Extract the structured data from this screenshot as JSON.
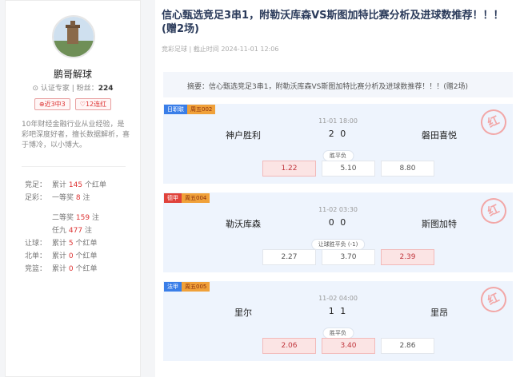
{
  "sidebar": {
    "username": "鹏哥解球",
    "cert_label": "认证专家",
    "fans_label": "粉丝：",
    "fans_count": "224",
    "badges": [
      "近3中3",
      "12连红"
    ],
    "bio": "10年财经金融行业从业经验，是彩吧深度好者，擅长数据解析，喜于博冷，以小博大。",
    "stats": {
      "jingzu": {
        "label": "竞足：",
        "prefix": "累计",
        "num": "145",
        "suffix": "个红单"
      },
      "zucai_1": {
        "label": "足彩：",
        "prefix": "一等奖",
        "num": "8",
        "suffix": "注"
      },
      "zucai_2": {
        "prefix": "二等奖",
        "num": "159",
        "suffix": "注"
      },
      "zucai_3": {
        "prefix": "任九",
        "num": "477",
        "suffix": "注"
      },
      "rangqiu": {
        "label": "让球：",
        "prefix": "累计",
        "num": "5",
        "suffix": "个红单"
      },
      "beidan": {
        "label": "北单：",
        "prefix": "累计",
        "num": "0",
        "suffix": "个红单"
      },
      "jinglan": {
        "label": "竞篮：",
        "prefix": "累计",
        "num": "0",
        "suffix": "个红单"
      }
    }
  },
  "article": {
    "title": "信心甄选竞足3串1，附勒沃库森VS斯图加特比赛分析及进球数推荐！！！(赠2场)",
    "category": "竞彩足球",
    "time_label": "截止时间",
    "time": "2024-11-01 12:06",
    "summary": "摘要：信心甄选竞足3串1，附勒沃库森VS斯图加特比赛分析及进球数推荐！！！(赠2场)"
  },
  "matches": [
    {
      "league": "日职联",
      "code": "周五002",
      "league_color": "#3a7ee8",
      "time": "11-01 18:00",
      "home": "神户胜利",
      "score": "2 0",
      "away": "磐田喜悦",
      "market": "胜平负",
      "odds": [
        "1.22",
        "5.10",
        "8.80"
      ],
      "hits": [
        true,
        false,
        false
      ]
    },
    {
      "league": "德甲",
      "code": "周五004",
      "league_color": "#e0423b",
      "time": "11-02 03:30",
      "home": "勒沃库森",
      "score": "0 0",
      "away": "斯图加特",
      "market": "让球胜平负 (-1)",
      "odds": [
        "2.27",
        "3.70",
        "2.39"
      ],
      "hits": [
        false,
        false,
        true
      ]
    },
    {
      "league": "法甲",
      "code": "周五005",
      "league_color": "#3a7ee8",
      "time": "11-02 04:00",
      "home": "里尔",
      "score": "1 1",
      "away": "里昂",
      "market": "胜平负",
      "odds": [
        "2.06",
        "3.40",
        "2.86"
      ],
      "hits": [
        true,
        true,
        false
      ]
    }
  ],
  "stamp_text": "红",
  "colors": {
    "accent_red": "#d33",
    "title_blue": "#2a3a5a",
    "card_bg": "#eef4fd"
  }
}
